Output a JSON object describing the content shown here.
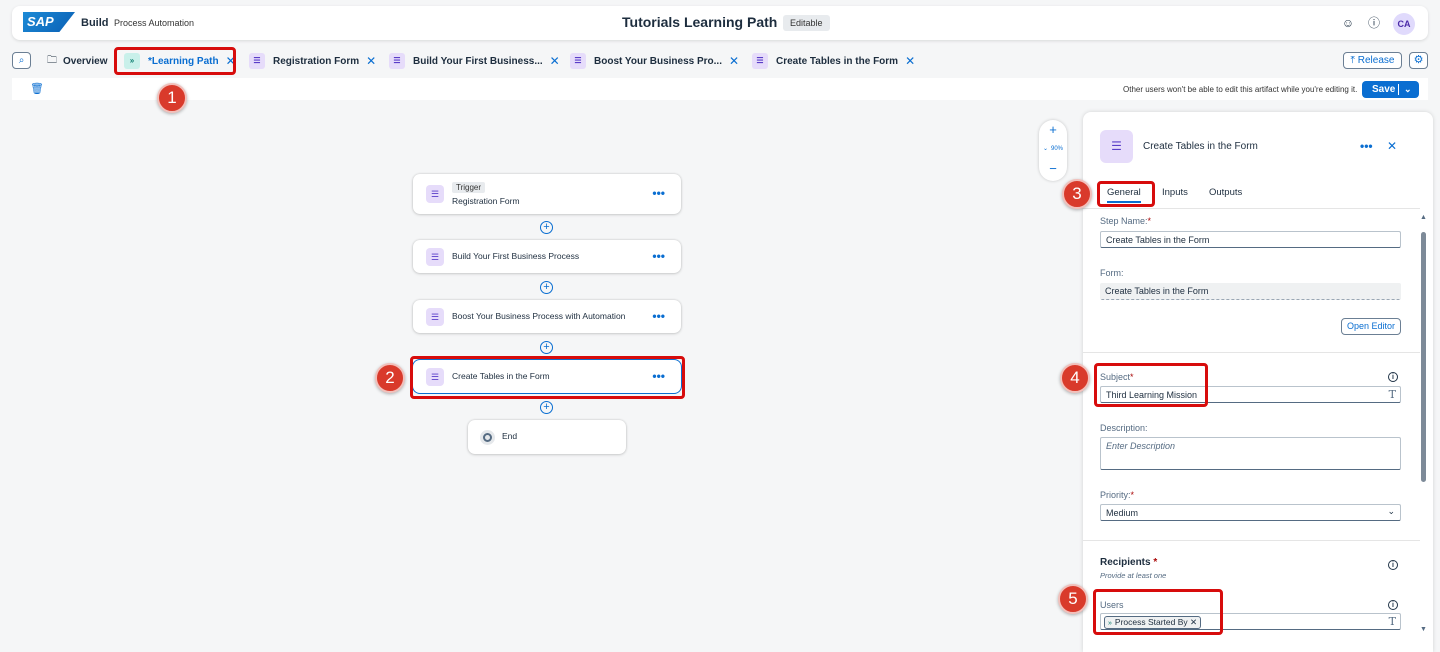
{
  "shell": {
    "logo": "SAP",
    "product": "Build",
    "subtitle": "Process Automation",
    "title": "Tutorials Learning Path",
    "status": "Editable",
    "avatar_initials": "CA"
  },
  "tabs": [
    {
      "label": "Overview"
    },
    {
      "label": "*Learning Path"
    },
    {
      "label": "Registration Form"
    },
    {
      "label": "Build Your First Business..."
    },
    {
      "label": "Boost Your Business Pro..."
    },
    {
      "label": "Create Tables in the Form"
    }
  ],
  "toolbar": {
    "release_label": "Release",
    "lock_note": "Other users won't be able to edit this artifact while you're editing it.",
    "save_label": "Save"
  },
  "canvas": {
    "trigger_chip": "Trigger",
    "nodes": [
      {
        "label": "Registration Form"
      },
      {
        "label": "Build Your First Business Process"
      },
      {
        "label": "Boost Your Business Process with Automation"
      },
      {
        "label": "Create Tables in the Form"
      },
      {
        "label": "End"
      }
    ],
    "zoom_level": "90%"
  },
  "panel": {
    "title": "Create Tables in the Form",
    "tabs": [
      "General",
      "Inputs",
      "Outputs"
    ],
    "step_name_label": "Step Name:",
    "step_name_value": "Create Tables in the Form",
    "form_label": "Form:",
    "form_value": "Create Tables in the Form",
    "open_editor_label": "Open Editor",
    "subject_label": "Subject",
    "subject_value": "Third Learning Mission",
    "description_label": "Description:",
    "description_placeholder": "Enter Description",
    "priority_label": "Priority:",
    "priority_value": "Medium",
    "recipients_title": "Recipients",
    "recipients_hint": "Provide at least one",
    "users_label": "Users",
    "users_token": "Process Started By"
  },
  "annotations": [
    "1",
    "2",
    "3",
    "4",
    "5"
  ],
  "colors": {
    "accent": "#0a6ed1",
    "highlight": "#d70c0c",
    "badge": "#d93a2b",
    "form_icon_bg": "#e6dcfa"
  }
}
